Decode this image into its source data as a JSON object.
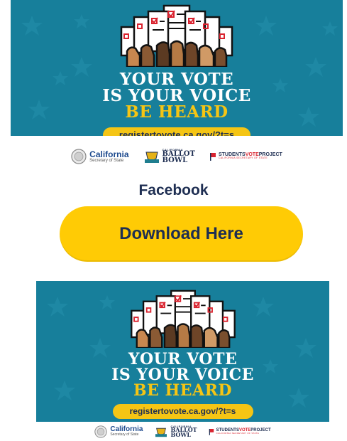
{
  "banner": {
    "headline_line1": "YOUR VOTE",
    "headline_line2": "IS YOUR VOICE",
    "headline_line3": "BE HEARD",
    "url": "registertovote.ca.gov/?t=s",
    "logo_ca_name": "California",
    "logo_ca_sub": "Secretary of State",
    "logo_bb_small": "CALIFORNIA",
    "logo_bb_line1": "BALLOT",
    "logo_bb_line2": "BOWL",
    "logo_svp_part1": "STUDENTS",
    "logo_svp_part2": "VOTE",
    "logo_svp_part3": "PROJECT",
    "logo_svp_sub": "CALIFORNIA SECRETARY OF STATE"
  },
  "section": {
    "label": "Facebook"
  },
  "download": {
    "label": "Download Here"
  },
  "colors": {
    "banner_blue": "#177f9b",
    "accent_yellow": "#f5c514",
    "button_yellow": "#ffcb05",
    "navy": "#1e2e52"
  },
  "icons": [
    "ballot-hands-icon",
    "star-pattern",
    "state-seal-icon",
    "trophy-icon",
    "svp-flag-icon"
  ]
}
